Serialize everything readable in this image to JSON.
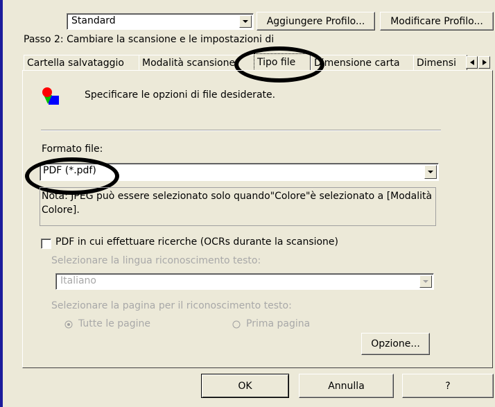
{
  "profile": {
    "selected": "Standard",
    "add_button": "Aggiungere Profilo...",
    "modify_button": "Modificare Profilo..."
  },
  "step_label": "Passo 2: Cambiare la scansione e le impostazioni di",
  "tabs": [
    {
      "label": "Cartella salvataggio"
    },
    {
      "label": "Modalità scansione"
    },
    {
      "label": "Tipo file"
    },
    {
      "label": "Dimensione carta"
    },
    {
      "label": "Dimensi"
    }
  ],
  "panel": {
    "intro": "Specificare le opzioni di file desiderate.",
    "format_label": "Formato file:",
    "format_value": "PDF (*.pdf)",
    "note": "Nota: JPEG può essere selezionato solo quando\"Colore\"è selezionato a [Modalità Colore].",
    "ocr_checkbox": "PDF in cui effettuare ricerche (OCRs durante la scansione)",
    "lang_label": "Selezionare la lingua riconoscimento testo:",
    "lang_value": "Italiano",
    "page_label": "Selezionare la pagina per il riconoscimento testo:",
    "radio_all": "Tutte le pagine",
    "radio_first": "Prima pagina",
    "option_button": "Opzione..."
  },
  "footer": {
    "ok": "OK",
    "cancel": "Annulla",
    "help": "?"
  },
  "colors": {
    "dialog_bg": "#ece9d8",
    "left_accent": "#1c1c9c",
    "annotation": "#000000"
  }
}
